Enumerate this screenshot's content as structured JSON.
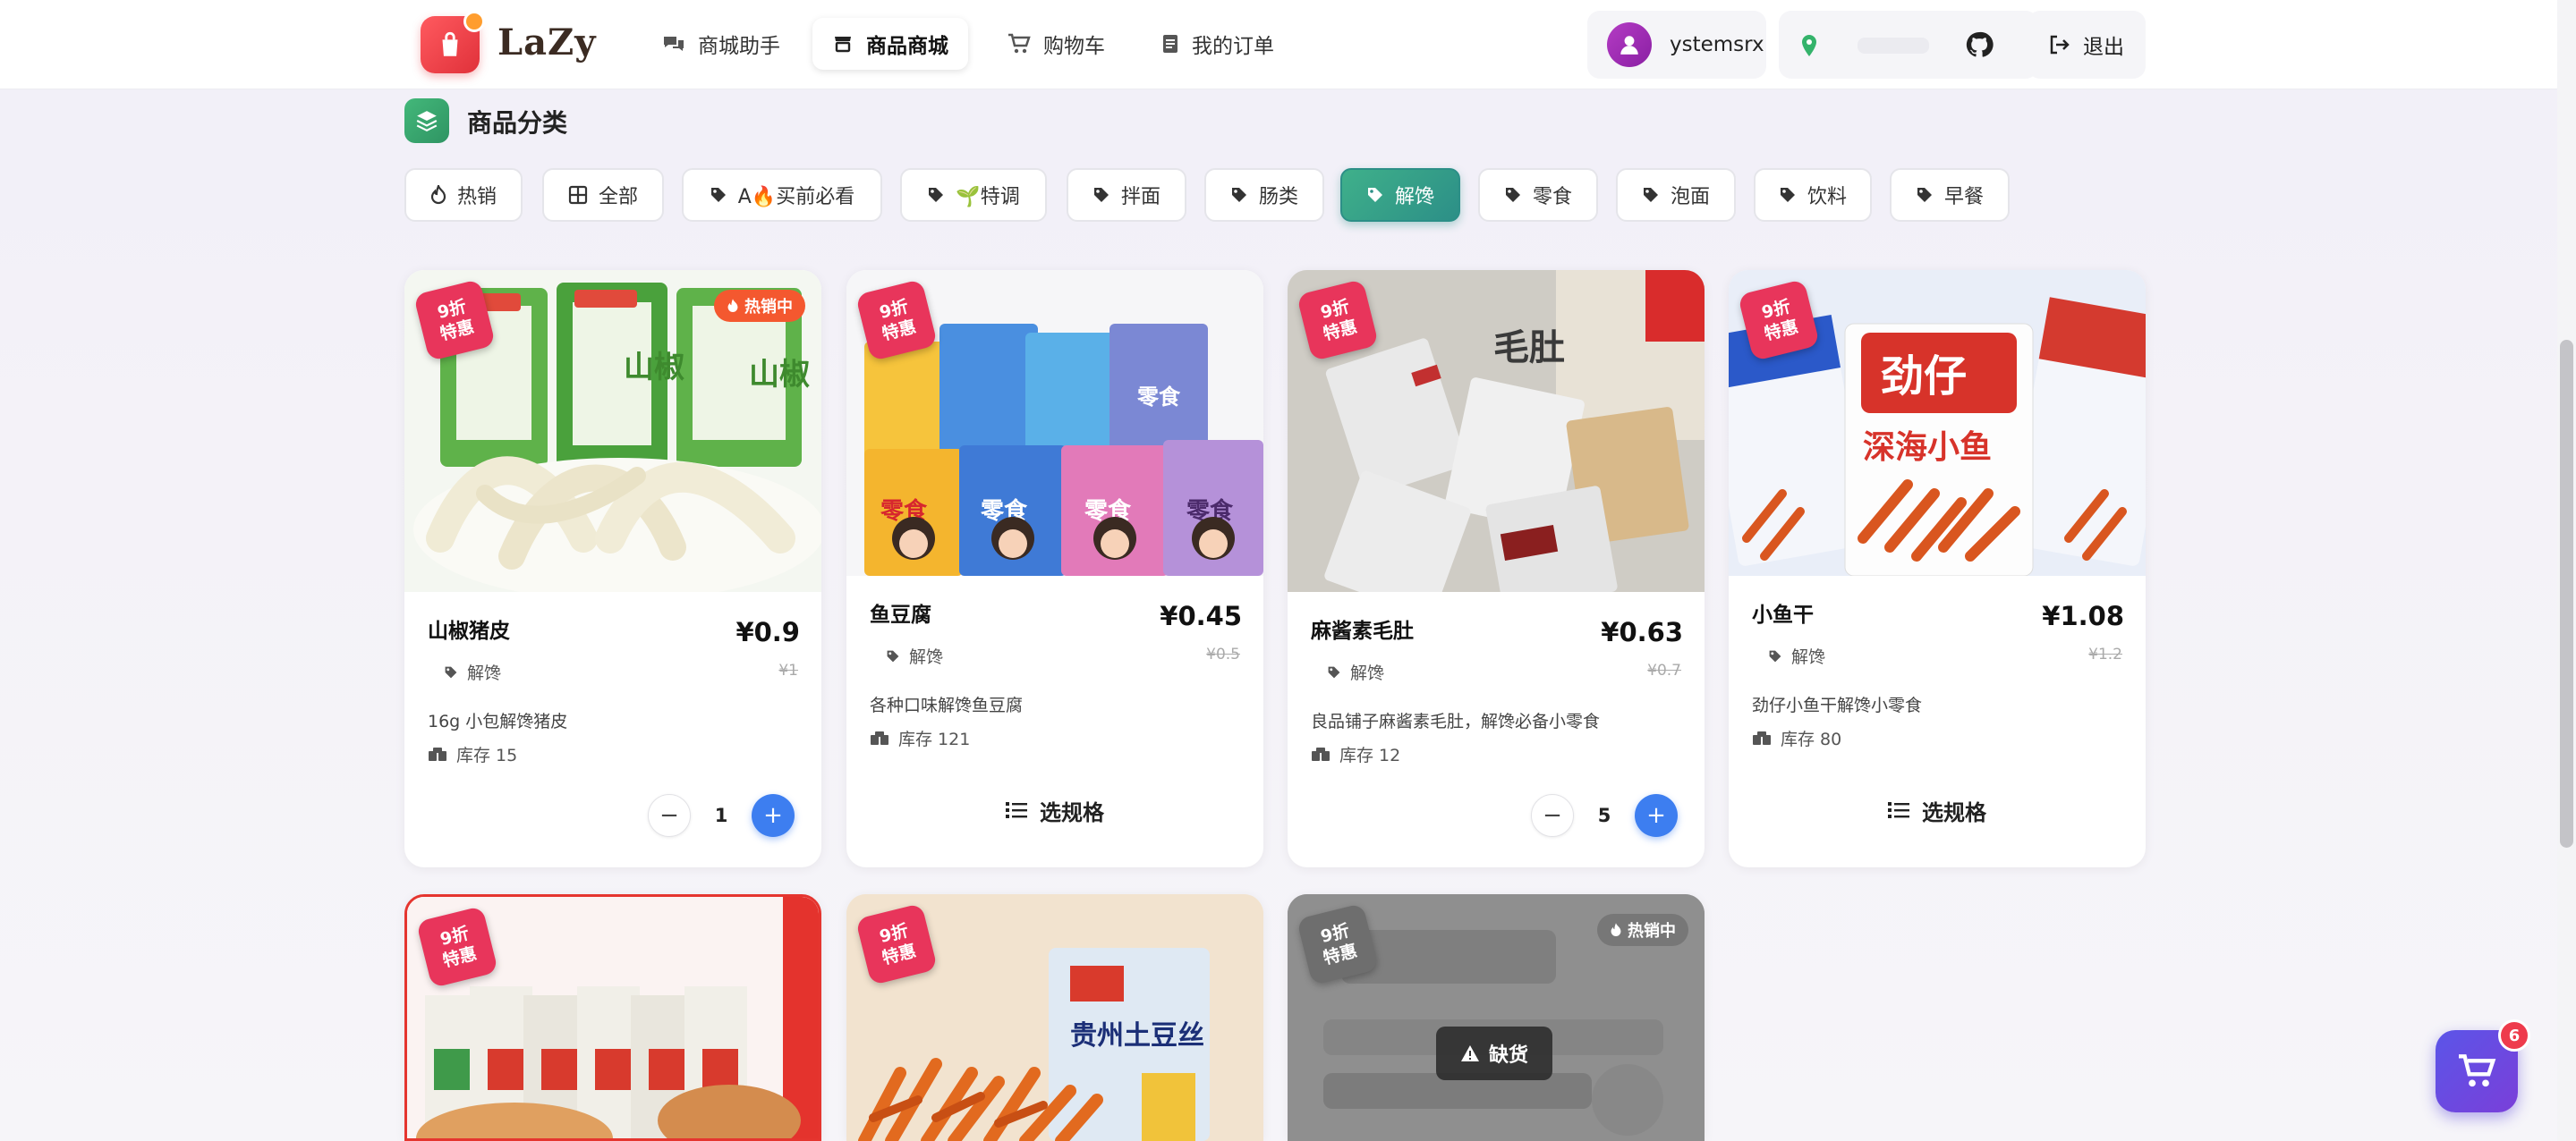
{
  "header": {
    "logo_text": "LaZy",
    "nav": [
      {
        "label": "商城助手",
        "icon": "chat-icon",
        "active": false
      },
      {
        "label": "商品商城",
        "icon": "store-icon",
        "active": true
      },
      {
        "label": "购物车",
        "icon": "cart-icon",
        "active": false
      },
      {
        "label": "我的订单",
        "icon": "order-icon",
        "active": false
      }
    ],
    "username": "ystemsrx",
    "logout_label": "退出"
  },
  "category": {
    "title": "商品分类",
    "chips": [
      {
        "label": "热销",
        "icon": "fire-icon"
      },
      {
        "label": "全部",
        "icon": "grid-icon"
      },
      {
        "label": "A🔥买前必看",
        "icon": "tag-icon"
      },
      {
        "label": "🌱特调",
        "icon": "tag-icon"
      },
      {
        "label": "拌面",
        "icon": "tag-icon"
      },
      {
        "label": "肠类",
        "icon": "tag-icon"
      },
      {
        "label": "解馋",
        "icon": "tag-icon",
        "active": true
      },
      {
        "label": "零食",
        "icon": "tag-icon"
      },
      {
        "label": "泡面",
        "icon": "tag-icon"
      },
      {
        "label": "饮料",
        "icon": "tag-icon"
      },
      {
        "label": "早餐",
        "icon": "tag-icon"
      }
    ]
  },
  "products": [
    {
      "name": "山椒猪皮",
      "price": "¥0.9",
      "old_price": "¥1",
      "tag": "解馋",
      "desc": "16g 小包解馋猪皮",
      "stock": "库存 15",
      "badge": "9折\n特惠",
      "hot": "热销中",
      "quantity": "1"
    },
    {
      "name": "鱼豆腐",
      "price": "¥0.45",
      "old_price": "¥0.5",
      "tag": "解馋",
      "desc": "各种口味解馋鱼豆腐",
      "stock": "库存 121",
      "badge": "9折\n特惠",
      "action": "选规格"
    },
    {
      "name": "麻酱素毛肚",
      "price": "¥0.63",
      "old_price": "¥0.7",
      "tag": "解馋",
      "desc": "良品铺子麻酱素毛肚，解馋必备小零食",
      "stock": "库存 12",
      "badge": "9折\n特惠",
      "quantity": "5"
    },
    {
      "name": "小鱼干",
      "price": "¥1.08",
      "old_price": "¥1.2",
      "tag": "解馋",
      "desc": "劲仔小鱼干解馋小零食",
      "stock": "库存 80",
      "badge": "9折\n特惠",
      "action": "选规格"
    },
    {
      "badge": "9折\n特惠"
    },
    {
      "badge": "9折\n特惠"
    },
    {
      "badge": "9折\n特惠",
      "hot": "热销中",
      "soldout": "缺货"
    }
  ],
  "product_images": {
    "p1_packs": [
      "山椒",
      "山椒"
    ],
    "p2_labels": [
      "零食",
      "零食",
      "零食",
      "零食",
      "零食"
    ],
    "p3_label": "毛肚",
    "p4_text": [
      "劲仔",
      "深海小鱼"
    ],
    "p6_text": "贵州土豆丝"
  },
  "cart_fab": {
    "count": "6"
  },
  "colors": {
    "accent_green": "#2c8f87",
    "badge_red": "#e8355b",
    "plus_blue": "#3d7ef0",
    "cart_purple": "#5b55e8"
  }
}
